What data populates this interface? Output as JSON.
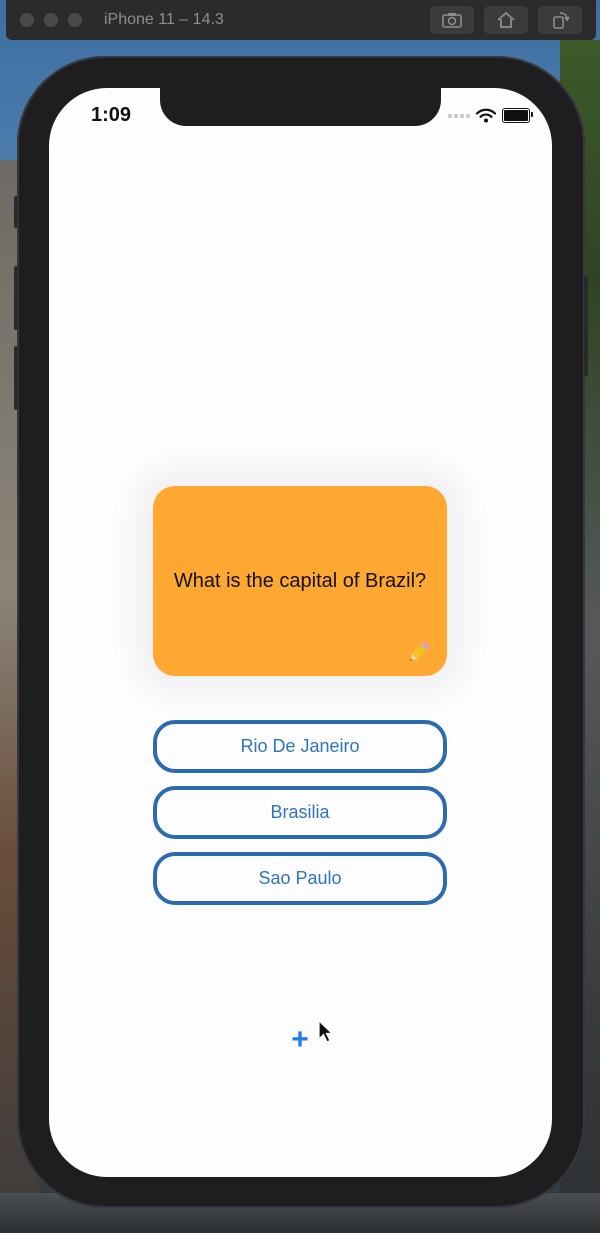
{
  "simulator": {
    "title": "iPhone 11 – 14.3"
  },
  "status_bar": {
    "time": "1:09"
  },
  "card": {
    "question": "What is the capital of Brazil?",
    "edit_icon": "pencil-icon",
    "color": "#fea832"
  },
  "answers": [
    {
      "label": "Rio De Janeiro"
    },
    {
      "label": "Brasilia"
    },
    {
      "label": "Sao Paulo"
    }
  ],
  "add_button": {
    "label": "+"
  },
  "colors": {
    "accent": "#2f74c0",
    "border": "#2d6bb0",
    "add": "#1f7af0"
  }
}
